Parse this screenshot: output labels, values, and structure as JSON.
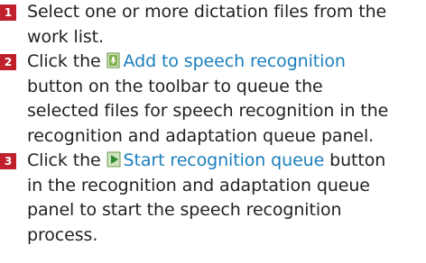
{
  "steps": [
    {
      "number": "1",
      "lines": [
        "Select one or more dictation files from the",
        "work list."
      ]
    },
    {
      "number": "2",
      "line1_prefix": "Click the ",
      "button_label": "Add to speech recognition",
      "button_icon": "add-to-speech-recognition-icon",
      "lines": [
        "button on the toolbar to queue the",
        "selected files for speech recognition in the",
        "recognition and adaptation queue panel."
      ]
    },
    {
      "number": "3",
      "line1_prefix": "Click the ",
      "button_label": "Start recognition queue",
      "line1_suffix": " button",
      "button_icon": "start-recognition-queue-icon",
      "lines": [
        "in the recognition and adaptation queue",
        "panel to start the speech recognition",
        "process."
      ]
    }
  ],
  "colors": {
    "badge": "#c0202c",
    "link": "#1a7fbe",
    "text": "#231f20"
  }
}
